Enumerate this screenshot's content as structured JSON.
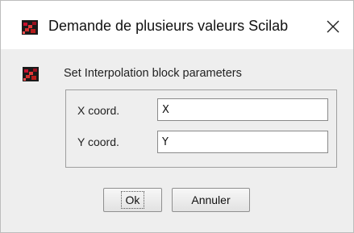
{
  "window": {
    "title": "Demande de plusieurs valeurs Scilab",
    "icon": "scilab-logo-icon",
    "close_icon": "close-icon"
  },
  "dialog": {
    "message": "Set Interpolation block parameters",
    "fields": [
      {
        "label": "X coord.",
        "value": "X"
      },
      {
        "label": "Y coord.",
        "value": "Y"
      }
    ]
  },
  "buttons": {
    "ok_label": "Ok",
    "cancel_label": "Annuler"
  }
}
